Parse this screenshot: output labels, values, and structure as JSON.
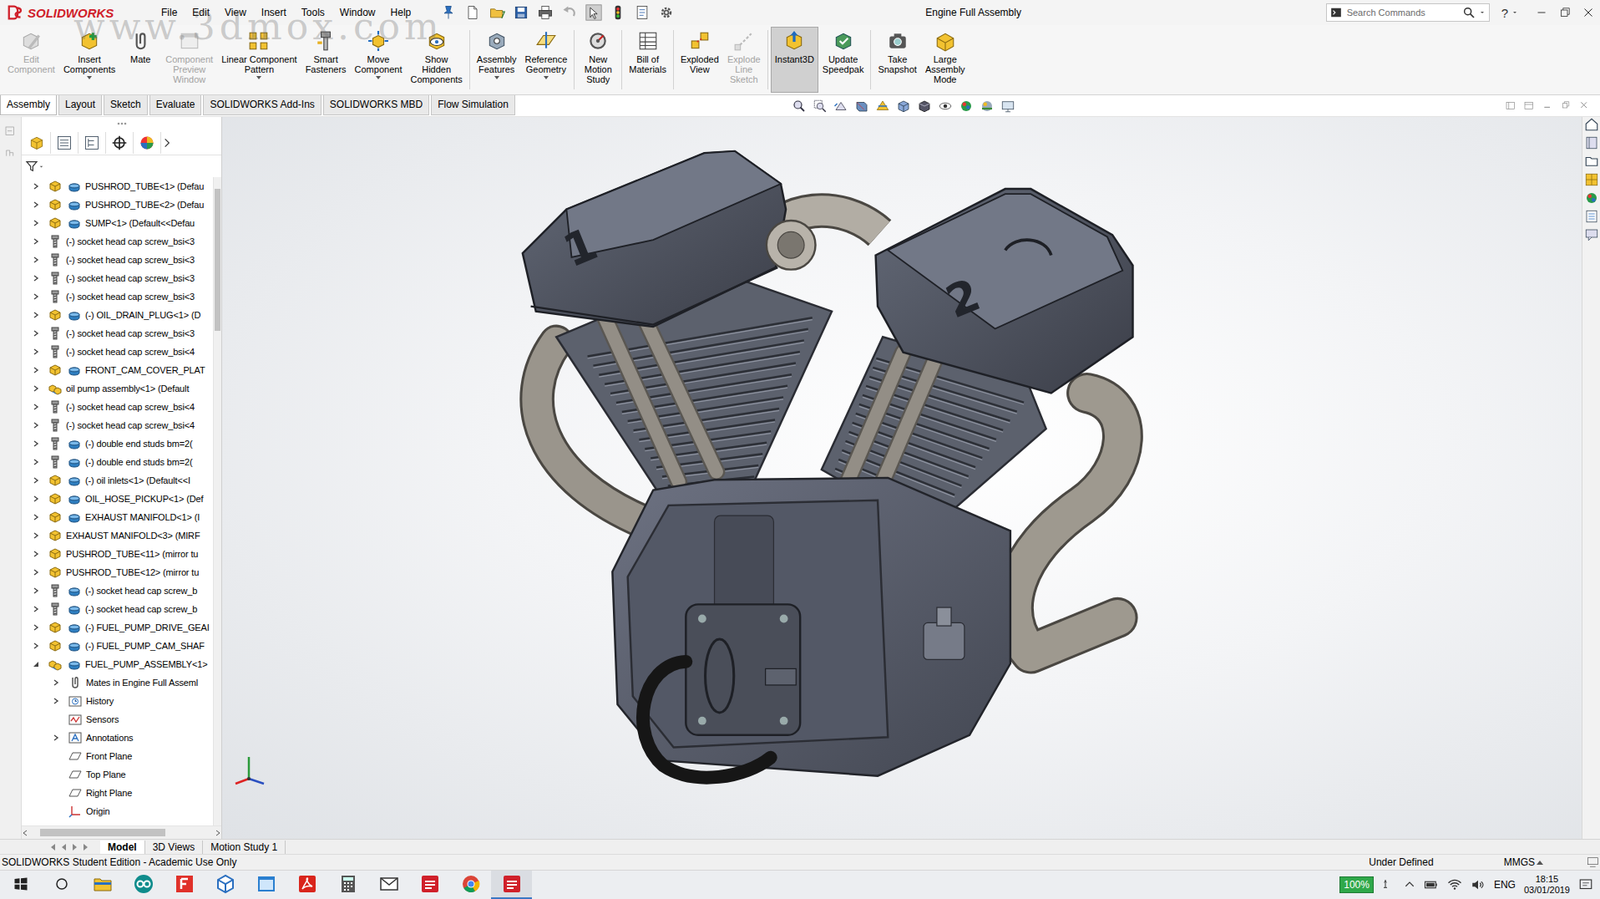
{
  "window": {
    "title": "Engine Full Assembly",
    "logo": "SOLIDWORKS",
    "watermark": "www.3dmox.com",
    "help": "?"
  },
  "menu": [
    "File",
    "Edit",
    "View",
    "Insert",
    "Tools",
    "Window",
    "Help"
  ],
  "search": {
    "placeholder": "Search Commands"
  },
  "ribbon": [
    {
      "label": "Edit\nComponent",
      "disabled": true,
      "selected": false,
      "dropdown": false
    },
    {
      "label": "Insert\nComponents",
      "disabled": false,
      "selected": false,
      "dropdown": true
    },
    {
      "label": "Mate",
      "disabled": false,
      "selected": false,
      "dropdown": false
    },
    {
      "label": "Component\nPreview\nWindow",
      "disabled": true,
      "selected": false,
      "dropdown": false
    },
    {
      "label": "Linear Component\nPattern",
      "disabled": false,
      "selected": false,
      "dropdown": true
    },
    {
      "label": "Smart\nFasteners",
      "disabled": false,
      "selected": false,
      "dropdown": false
    },
    {
      "label": "Move\nComponent",
      "disabled": false,
      "selected": false,
      "dropdown": true
    },
    {
      "label": "Show\nHidden\nComponents",
      "disabled": false,
      "selected": false,
      "dropdown": false
    },
    {
      "label": "Assembly\nFeatures",
      "disabled": false,
      "selected": false,
      "dropdown": true
    },
    {
      "label": "Reference\nGeometry",
      "disabled": false,
      "selected": false,
      "dropdown": true
    },
    {
      "label": "New\nMotion\nStudy",
      "disabled": false,
      "selected": false,
      "dropdown": false
    },
    {
      "label": "Bill of\nMaterials",
      "disabled": false,
      "selected": false,
      "dropdown": false
    },
    {
      "label": "Exploded\nView",
      "disabled": false,
      "selected": false,
      "dropdown": false
    },
    {
      "label": "Explode\nLine\nSketch",
      "disabled": true,
      "selected": false,
      "dropdown": false
    },
    {
      "label": "Instant3D",
      "disabled": false,
      "selected": true,
      "dropdown": false
    },
    {
      "label": "Update\nSpeedpak",
      "disabled": false,
      "selected": false,
      "dropdown": false
    },
    {
      "label": "Take\nSnapshot",
      "disabled": false,
      "selected": false,
      "dropdown": false
    },
    {
      "label": "Large\nAssembly\nMode",
      "disabled": false,
      "selected": false,
      "dropdown": false
    }
  ],
  "tabs": [
    {
      "label": "Assembly",
      "selected": true
    },
    {
      "label": "Layout",
      "selected": false
    },
    {
      "label": "Sketch",
      "selected": false
    },
    {
      "label": "Evaluate",
      "selected": false
    },
    {
      "label": "SOLIDWORKS Add-Ins",
      "selected": false
    },
    {
      "label": "SOLIDWORKS MBD",
      "selected": false
    },
    {
      "label": "Flow Simulation",
      "selected": false
    }
  ],
  "tree": {
    "items": [
      {
        "text": "PUSHROD_TUBE<1> (Defau",
        "kind": "part",
        "configured": true,
        "indent": 0,
        "has_children": true,
        "expanded": false
      },
      {
        "text": "PUSHROD_TUBE<2> (Defau",
        "kind": "part",
        "configured": true,
        "indent": 0,
        "has_children": true,
        "expanded": false
      },
      {
        "text": "SUMP<1> (Default<<Defau",
        "kind": "part",
        "configured": true,
        "indent": 0,
        "has_children": true,
        "expanded": false
      },
      {
        "text": "(-) socket head cap screw_bsi<3",
        "kind": "screw",
        "configured": false,
        "indent": 0,
        "has_children": true,
        "expanded": false
      },
      {
        "text": "(-) socket head cap screw_bsi<3",
        "kind": "screw",
        "configured": false,
        "indent": 0,
        "has_children": true,
        "expanded": false
      },
      {
        "text": "(-) socket head cap screw_bsi<3",
        "kind": "screw",
        "configured": false,
        "indent": 0,
        "has_children": true,
        "expanded": false
      },
      {
        "text": "(-) socket head cap screw_bsi<3",
        "kind": "screw",
        "configured": false,
        "indent": 0,
        "has_children": true,
        "expanded": false
      },
      {
        "text": "(-) OIL_DRAIN_PLUG<1> (D",
        "kind": "part",
        "configured": true,
        "indent": 0,
        "has_children": true,
        "expanded": false
      },
      {
        "text": "(-) socket head cap screw_bsi<3",
        "kind": "screw",
        "configured": false,
        "indent": 0,
        "has_children": true,
        "expanded": false
      },
      {
        "text": "(-) socket head cap screw_bsi<4",
        "kind": "screw",
        "configured": false,
        "indent": 0,
        "has_children": true,
        "expanded": false
      },
      {
        "text": "FRONT_CAM_COVER_PLAT",
        "kind": "part",
        "configured": true,
        "indent": 0,
        "has_children": true,
        "expanded": false
      },
      {
        "text": "oil pump assembly<1> (Default",
        "kind": "assembly",
        "configured": false,
        "indent": 0,
        "has_children": true,
        "expanded": false
      },
      {
        "text": "(-) socket head cap screw_bsi<4",
        "kind": "screw",
        "configured": false,
        "indent": 0,
        "has_children": true,
        "expanded": false
      },
      {
        "text": "(-) socket head cap screw_bsi<4",
        "kind": "screw",
        "configured": false,
        "indent": 0,
        "has_children": true,
        "expanded": false
      },
      {
        "text": "(-) double end studs bm=2(",
        "kind": "screw",
        "configured": true,
        "indent": 0,
        "has_children": true,
        "expanded": false
      },
      {
        "text": "(-) double end studs bm=2(",
        "kind": "screw",
        "configured": true,
        "indent": 0,
        "has_children": true,
        "expanded": false
      },
      {
        "text": "(-) oil inlets<1> (Default<<I",
        "kind": "part",
        "configured": true,
        "indent": 0,
        "has_children": true,
        "expanded": false
      },
      {
        "text": "OIL_HOSE_PICKUP<1> (Def",
        "kind": "part",
        "configured": true,
        "indent": 0,
        "has_children": true,
        "expanded": false
      },
      {
        "text": "EXHAUST MANIFOLD<1> (I",
        "kind": "part",
        "configured": true,
        "indent": 0,
        "has_children": true,
        "expanded": false
      },
      {
        "text": "EXHAUST MANIFOLD<3> (MIRF",
        "kind": "part",
        "configured": false,
        "indent": 0,
        "has_children": true,
        "expanded": false
      },
      {
        "text": "PUSHROD_TUBE<11> (mirror tu",
        "kind": "part",
        "configured": false,
        "indent": 0,
        "has_children": true,
        "expanded": false
      },
      {
        "text": "PUSHROD_TUBE<12> (mirror tu",
        "kind": "part",
        "configured": false,
        "indent": 0,
        "has_children": true,
        "expanded": false
      },
      {
        "text": "(-) socket head cap screw_b",
        "kind": "screw",
        "configured": true,
        "indent": 0,
        "has_children": true,
        "expanded": false
      },
      {
        "text": "(-) socket head cap screw_b",
        "kind": "screw",
        "configured": true,
        "indent": 0,
        "has_children": true,
        "expanded": false
      },
      {
        "text": "(-) FUEL_PUMP_DRIVE_GEAI",
        "kind": "part",
        "configured": true,
        "indent": 0,
        "has_children": true,
        "expanded": false
      },
      {
        "text": "(-) FUEL_PUMP_CAM_SHAF",
        "kind": "part",
        "configured": true,
        "indent": 0,
        "has_children": true,
        "expanded": false
      },
      {
        "text": "FUEL_PUMP_ASSEMBLY<1>",
        "kind": "assembly",
        "configured": true,
        "indent": 0,
        "has_children": true,
        "expanded": true
      },
      {
        "text": "Mates in Engine Full Asseml",
        "kind": "mates",
        "configured": false,
        "indent": 1,
        "has_children": true,
        "expanded": false
      },
      {
        "text": "History",
        "kind": "history",
        "configured": false,
        "indent": 1,
        "has_children": true,
        "expanded": false
      },
      {
        "text": "Sensors",
        "kind": "sensors",
        "configured": false,
        "indent": 1,
        "has_children": false,
        "expanded": false
      },
      {
        "text": "Annotations",
        "kind": "annotations",
        "configured": false,
        "indent": 1,
        "has_children": true,
        "expanded": false
      },
      {
        "text": "Front Plane",
        "kind": "plane",
        "configured": false,
        "indent": 1,
        "has_children": false,
        "expanded": false
      },
      {
        "text": "Top Plane",
        "kind": "plane",
        "configured": false,
        "indent": 1,
        "has_children": false,
        "expanded": false
      },
      {
        "text": "Right Plane",
        "kind": "plane",
        "configured": false,
        "indent": 1,
        "has_children": false,
        "expanded": false
      },
      {
        "text": "Origin",
        "kind": "origin",
        "configured": false,
        "indent": 1,
        "has_children": false,
        "expanded": false
      }
    ]
  },
  "model_tabs": [
    {
      "label": "Model",
      "selected": true
    },
    {
      "label": "3D Views",
      "selected": false
    },
    {
      "label": "Motion Study 1",
      "selected": false
    }
  ],
  "viewport": {
    "cylinder_labels": [
      "1",
      "2"
    ]
  },
  "status_bar": {
    "edition": "SOLIDWORKS Student Edition - Academic Use Only",
    "state": "Under Defined",
    "units": "MMGS"
  },
  "taskbar": {
    "apps": [
      {
        "kind": "explorer",
        "active": false
      },
      {
        "kind": "arduino",
        "active": false
      },
      {
        "kind": "foxit",
        "active": false
      },
      {
        "kind": "cube",
        "active": false
      },
      {
        "kind": "window",
        "active": false
      },
      {
        "kind": "acrobat",
        "active": false
      },
      {
        "kind": "calculator",
        "active": false
      },
      {
        "kind": "mail",
        "active": false
      },
      {
        "kind": "solidworks",
        "active": false
      },
      {
        "kind": "chrome",
        "active": false
      },
      {
        "kind": "solidworks",
        "active": true
      }
    ],
    "battery": "100%",
    "language": "ENG",
    "time": "18:15",
    "date": "03/01/2019"
  }
}
